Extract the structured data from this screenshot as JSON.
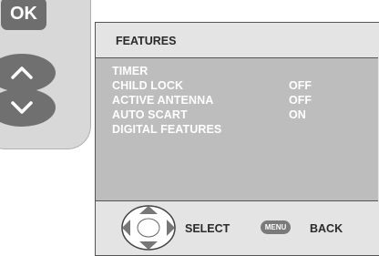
{
  "remote": {
    "ok_label": "OK",
    "up_icon": "chevron-up-icon",
    "down_icon": "chevron-down-icon"
  },
  "menu": {
    "title": "FEATURES",
    "items": [
      {
        "label": "TIMER",
        "value": ""
      },
      {
        "label": "CHILD LOCK",
        "value": "OFF"
      },
      {
        "label": "ACTIVE ANTENNA",
        "value": "OFF"
      },
      {
        "label": "AUTO SCART",
        "value": "ON"
      },
      {
        "label": "DIGITAL FEATURES",
        "value": ""
      }
    ]
  },
  "footer": {
    "dpad_icon": "dpad-icon",
    "select_label": "SELECT",
    "menu_badge": "MENU",
    "back_label": "BACK"
  },
  "colors": {
    "remote_body": "#d8d8d8",
    "remote_buttons": "#6e6e6e",
    "menu_background": "#e4e4e4",
    "menu_highlight": "#bdbdbd",
    "menu_text": "#ffffff"
  }
}
